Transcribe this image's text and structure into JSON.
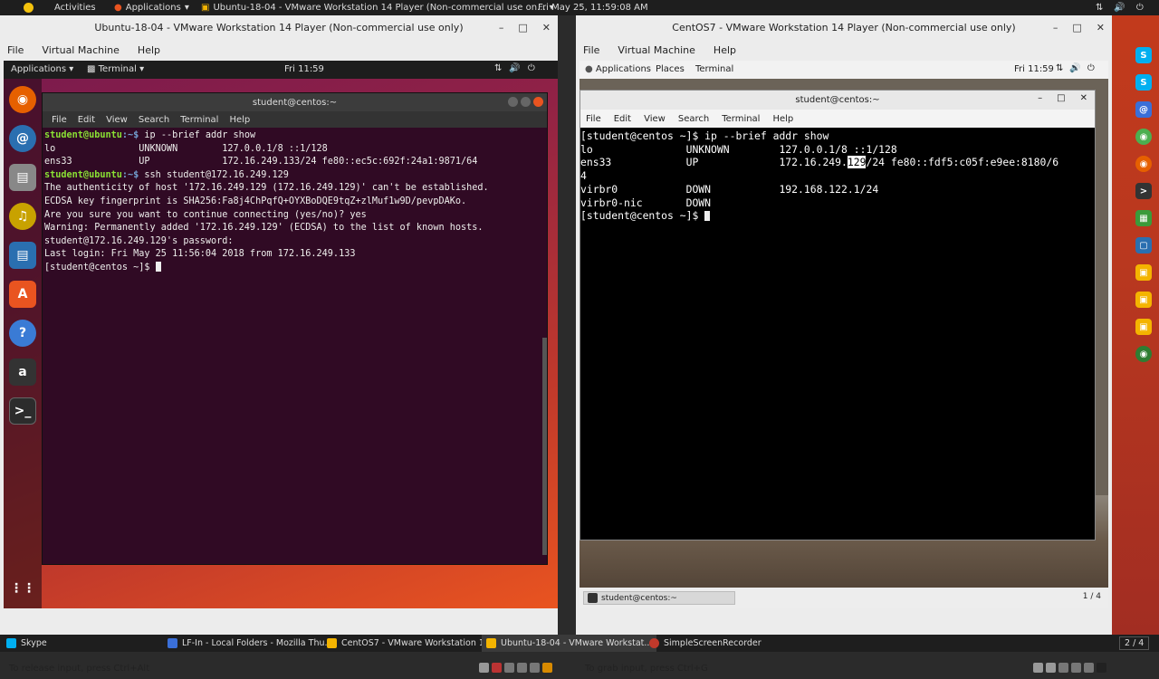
{
  "host_topbar": {
    "activities": "Activities",
    "applications": "Applications",
    "window_title": "Ubuntu-18-04 - VMware Workstation 14 Player (Non-commercial use on...",
    "clock": "Fri May 25, 11:59:08 AM"
  },
  "ubuntu_vm": {
    "title": "Ubuntu-18-04 - VMware Workstation 14 Player (Non-commercial use only)",
    "menu": [
      "File",
      "Virtual Machine",
      "Help"
    ],
    "panel": {
      "applications": "Applications",
      "terminal": "Terminal",
      "clock": "Fri 11:59"
    },
    "terminal": {
      "title": "student@centos:~",
      "menu": [
        "File",
        "Edit",
        "View",
        "Search",
        "Terminal",
        "Help"
      ],
      "lines": [
        {
          "prompt_user": "student@ubuntu",
          "prompt_path": ":~$",
          "cmd": " ip --brief addr show"
        },
        {
          "text": "lo               UNKNOWN        127.0.0.1/8 ::1/128"
        },
        {
          "text": "ens33            UP             172.16.249.133/24 fe80::ec5c:692f:24a1:9871/64"
        },
        {
          "prompt_user": "student@ubuntu",
          "prompt_path": ":~$",
          "cmd": " ssh student@172.16.249.129"
        },
        {
          "text": "The authenticity of host '172.16.249.129 (172.16.249.129)' can't be established."
        },
        {
          "text": "ECDSA key fingerprint is SHA256:Fa8j4ChPqfQ+OYXBoDQE9tqZ+zlMuf1w9D/pevpDAKo."
        },
        {
          "text": "Are you sure you want to continue connecting (yes/no)? yes"
        },
        {
          "text": "Warning: Permanently added '172.16.249.129' (ECDSA) to the list of known hosts."
        },
        {
          "text": "student@172.16.249.129's password:"
        },
        {
          "text": "Last login: Fri May 25 11:56:04 2018 from 172.16.249.133"
        },
        {
          "text": "[student@centos ~]$ "
        }
      ]
    },
    "status": "To release input, press Ctrl+Alt"
  },
  "centos_vm": {
    "title": "CentOS7 - VMware Workstation 14 Player (Non-commercial use only)",
    "menu": [
      "File",
      "Virtual Machine",
      "Help"
    ],
    "panel": {
      "applications": "Applications",
      "places": "Places",
      "terminal": "Terminal",
      "clock": "Fri 11:59"
    },
    "terminal": {
      "title": "student@centos:~",
      "menu": [
        "File",
        "Edit",
        "View",
        "Search",
        "Terminal",
        "Help"
      ],
      "lines": [
        "[student@centos ~]$ ip --brief addr show",
        "lo               UNKNOWN        127.0.0.1/8 ::1/128",
        "ens33            UP             172.16.249.",
        "4",
        "virbr0           DOWN           192.168.122.1/24",
        "virbr0-nic       DOWN",
        "[student@centos ~]$ "
      ],
      "selected": "129",
      "ens33_tail": "/24 fe80::fdf5:c05f:e9ee:8180/6"
    },
    "taskbar": {
      "item": "student@centos:~",
      "pager": "1 / 4"
    },
    "status": "To grab input, press Ctrl+G"
  },
  "taskbar": {
    "items": [
      {
        "label": "Skype",
        "color": "#00aff0"
      },
      {
        "label": "LF-In - Local Folders - Mozilla Thu...",
        "color": "#3a6fd8"
      },
      {
        "label": "CentOS7 - VMware Workstation 1...",
        "color": "#f4b400"
      },
      {
        "label": "Ubuntu-18-04 - VMware Workstat...",
        "color": "#f4b400"
      },
      {
        "label": "SimpleScreenRecorder",
        "color": "#c0392b"
      }
    ],
    "pager": "2 / 4"
  }
}
